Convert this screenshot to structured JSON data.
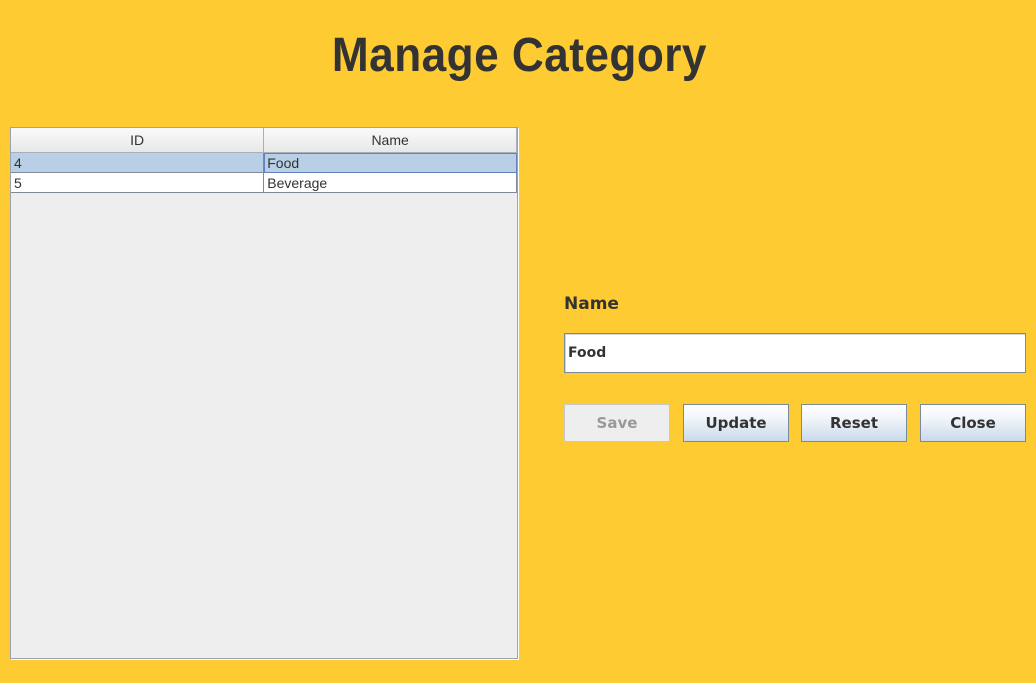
{
  "page": {
    "title": "Manage Category"
  },
  "table": {
    "columns": [
      "ID",
      "Name"
    ],
    "rows": [
      {
        "id": "4",
        "name": "Food",
        "selected": true
      },
      {
        "id": "5",
        "name": "Beverage",
        "selected": false
      }
    ]
  },
  "form": {
    "name_label": "Name",
    "name_value": "Food",
    "buttons": {
      "save": "Save",
      "update": "Update",
      "reset": "Reset",
      "close": "Close"
    },
    "save_enabled": false
  },
  "colors": {
    "background": "#FFCB33",
    "text": "#333333",
    "selection": "#B8CFE5"
  }
}
